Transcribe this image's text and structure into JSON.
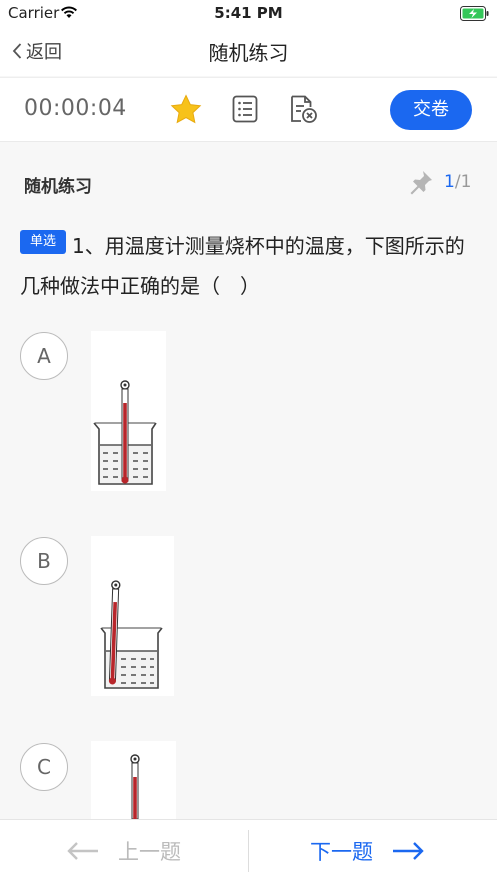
{
  "status_bar": {
    "carrier": "Carrier",
    "time": "5:41 PM"
  },
  "nav": {
    "back_label": "返回",
    "title": "随机练习"
  },
  "toolbar": {
    "timer": "00:00:04",
    "submit_label": "交卷"
  },
  "section": {
    "title": "随机练习",
    "progress_current": "1",
    "progress_sep": "/",
    "progress_total": "1"
  },
  "question": {
    "type_badge": "单选",
    "text": "1、用温度计测量烧杯中的温度，下图所示的几种做法中正确的是（　）"
  },
  "options": [
    {
      "label": "A"
    },
    {
      "label": "B"
    },
    {
      "label": "C"
    }
  ],
  "bottom": {
    "prev_label": "上一题",
    "next_label": "下一题"
  },
  "colors": {
    "accent": "#1b68f0",
    "star": "#f7c21a",
    "mercury": "#b8262b"
  }
}
